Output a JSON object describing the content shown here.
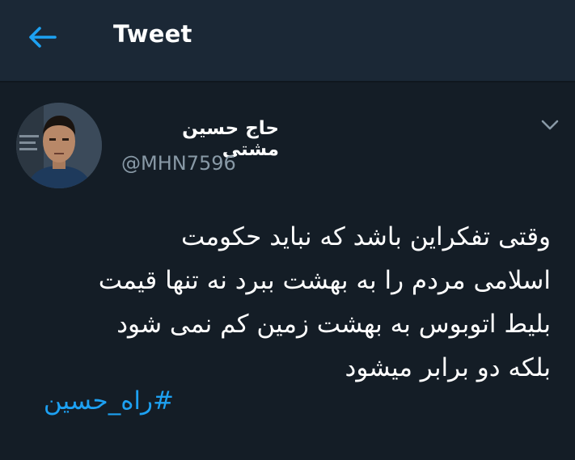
{
  "header": {
    "back_icon": "arrow-left-icon",
    "title": "Tweet"
  },
  "tweet": {
    "author": {
      "name": "حاج حسین مشتی",
      "handle": "@MHN7596",
      "avatar": "avatar-photo"
    },
    "menu_icon": "chevron-down-icon",
    "text_lines": [
      "وقتی تفکراین باشد که نباید حکومت",
      "اسلامی مردم را به بهشت ببرد نه تنها قیمت",
      "بلیط اتوبوس به بهشت زمین کم نمی شود",
      "بلکه دو برابر میشود"
    ],
    "hashtag": "#راه_حسین"
  },
  "colors": {
    "background": "#141d26",
    "header": "#1b2836",
    "accent": "#1da1f2",
    "secondary_text": "#8899a6"
  }
}
